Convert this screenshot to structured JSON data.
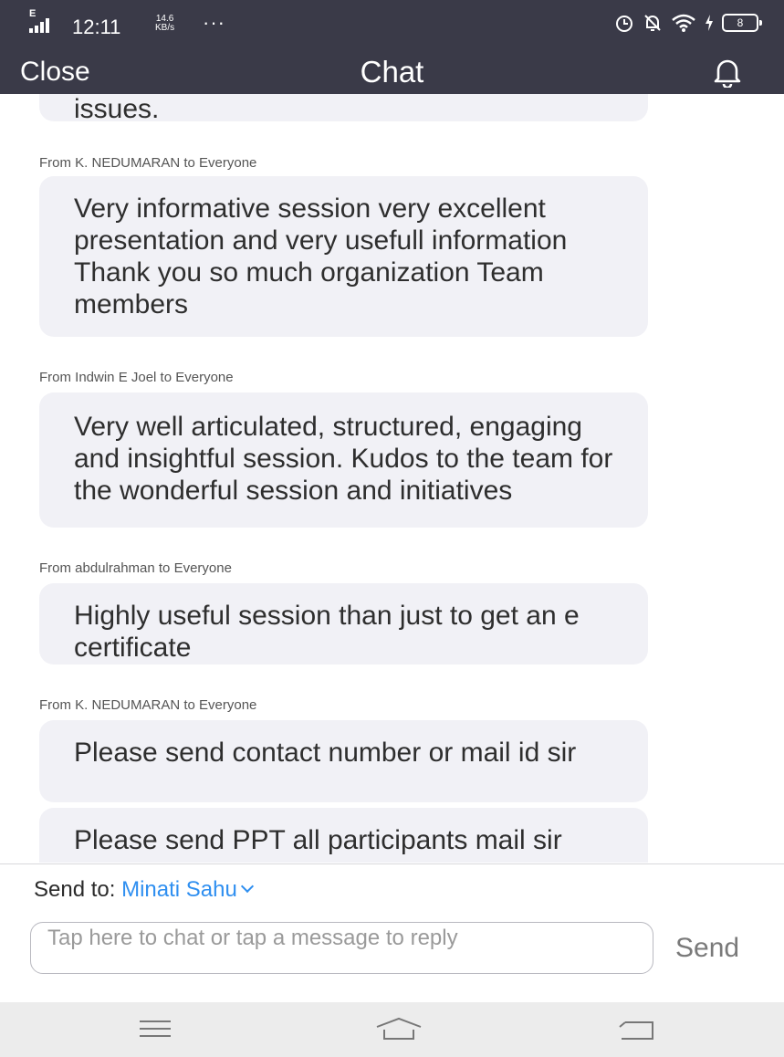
{
  "status_bar": {
    "signal_label": "E",
    "time": "12:11",
    "speed_value": "14.6",
    "speed_unit": "KB/s",
    "more": "···",
    "battery": "8"
  },
  "header": {
    "close_label": "Close",
    "title": "Chat"
  },
  "messages": [
    {
      "sender": "",
      "text": "issues."
    },
    {
      "sender": "From K. NEDUMARAN to Everyone",
      "text": "Very informative session very excellent presentation and very usefull information Thank you so much organization Team members"
    },
    {
      "sender": "From Indwin E Joel to Everyone",
      "text": "Very well articulated, structured, engaging and insightful session. Kudos to the team for the wonderful session and initiatives"
    },
    {
      "sender": "From abdulrahman to Everyone",
      "text": "Highly useful session than just to get an e certificate"
    },
    {
      "sender": "From K. NEDUMARAN to Everyone",
      "text": "Please send contact number or mail id sir"
    },
    {
      "sender": "",
      "text": "Please send PPT all participants mail sir"
    }
  ],
  "compose": {
    "send_to_label": "Send to:",
    "recipient": "Minati Sahu",
    "placeholder": "Tap here to chat or tap a message to reply",
    "send_label": "Send"
  },
  "colors": {
    "header_bg": "#3a3a48",
    "bubble_bg": "#f1f1f6",
    "accent": "#2f8ff0"
  }
}
